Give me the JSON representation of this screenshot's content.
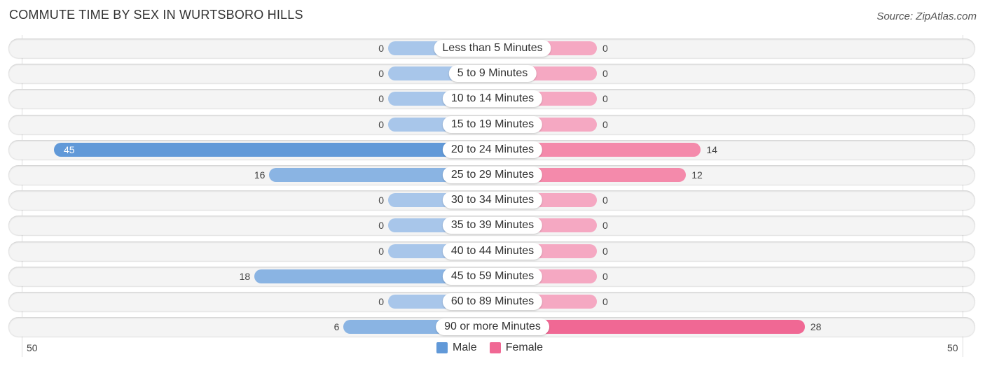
{
  "title": "COMMUTE TIME BY SEX IN WURTSBORO HILLS",
  "source": "Source: ZipAtlas.com",
  "colors": {
    "male": "#6199d8",
    "female": "#f06894",
    "male_light": "#a8c6ea",
    "female_light": "#f5a8c2"
  },
  "chart_data": {
    "type": "bar",
    "orientation": "horizontal-diverging",
    "title": "COMMUTE TIME BY SEX IN WURTSBORO HILLS",
    "categories": [
      "Less than 5 Minutes",
      "5 to 9 Minutes",
      "10 to 14 Minutes",
      "15 to 19 Minutes",
      "20 to 24 Minutes",
      "25 to 29 Minutes",
      "30 to 34 Minutes",
      "35 to 39 Minutes",
      "40 to 44 Minutes",
      "45 to 59 Minutes",
      "60 to 89 Minutes",
      "90 or more Minutes"
    ],
    "series": [
      {
        "name": "Male",
        "values": [
          0,
          0,
          0,
          0,
          45,
          16,
          0,
          0,
          0,
          18,
          0,
          6
        ]
      },
      {
        "name": "Female",
        "values": [
          0,
          0,
          0,
          0,
          14,
          12,
          0,
          0,
          0,
          0,
          0,
          28
        ]
      }
    ],
    "axis": {
      "left_label": "50",
      "right_label": "50",
      "range": [
        -50,
        50
      ]
    },
    "legend": {
      "position": "bottom-center",
      "entries": [
        "Male",
        "Female"
      ]
    }
  }
}
